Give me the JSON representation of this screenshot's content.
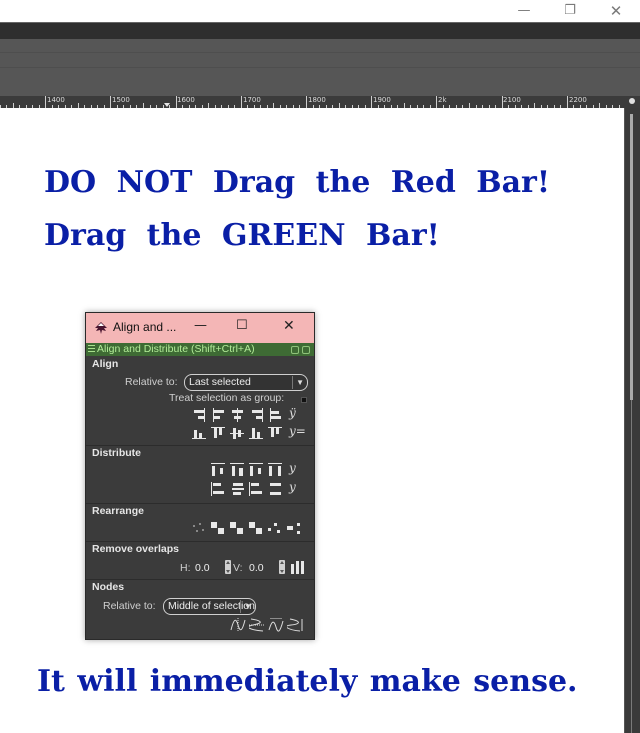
{
  "window_controls": {
    "minimize_glyph": "—",
    "restore_glyph": "❐",
    "close_glyph": "✕"
  },
  "ruler": {
    "labels": [
      "1400",
      "1500",
      "1600",
      "1700",
      "1800",
      "1900",
      "2k",
      "2100",
      "2200"
    ]
  },
  "canvas": {
    "line1": "DO NOT Drag the Red Bar!",
    "line2": "Drag the GREEN Bar!",
    "line3": "It will immediately make sense.",
    "text_color": "#0a1fa6"
  },
  "dialog": {
    "title": "Align and ...",
    "title_bar_color": "#f4b6b6",
    "minimize_glyph": "—",
    "maximize_glyph": "☐",
    "close_glyph": "✕",
    "dock_title": "Align and Distribute (Shift+Ctrl+A)",
    "dock_bar_color": "#3e6b34",
    "align": {
      "heading": "Align",
      "relative_label": "Relative to:",
      "relative_value": "Last selected",
      "treat_as_group_label": "Treat selection as group:"
    },
    "distribute": {
      "heading": "Distribute"
    },
    "rearrange": {
      "heading": "Rearrange"
    },
    "remove_overlaps": {
      "heading": "Remove overlaps",
      "h_label": "H:",
      "h_value": "0.0",
      "v_label": "V:",
      "v_value": "0.0"
    },
    "nodes": {
      "heading": "Nodes",
      "relative_label": "Relative to:",
      "relative_value": "Middle of selection"
    }
  }
}
